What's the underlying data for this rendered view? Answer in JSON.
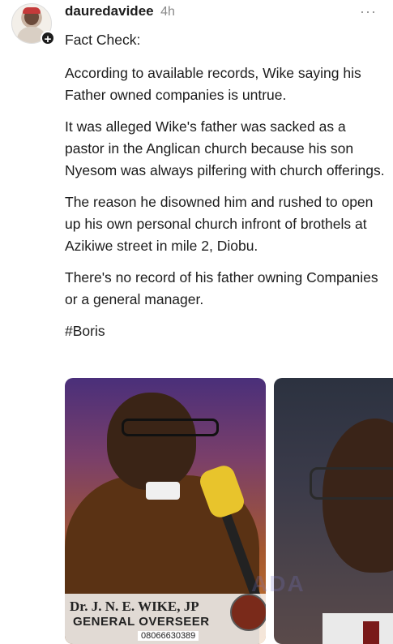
{
  "post": {
    "username": "dauredavidee",
    "time": "4h",
    "more_label": "···",
    "paragraphs": [
      "Fact Check:",
      "According to available records, Wike saying his Father owned companies is untrue.",
      "It was alleged Wike's father was sacked as a pastor in the Anglican church because his son Nyesom was always pilfering with church offerings.",
      "The reason he disowned him and rushed to open up his own personal church infront of brothels at Azikiwe street in mile 2, Diobu.",
      "There's no record of his father owning Companies or a general manager.",
      "#Boris"
    ]
  },
  "images": {
    "first": {
      "caption_name": "Dr. J. N. E. WIKE, JP",
      "caption_title": "GENERAL OVERSEER",
      "caption_phone": "08066630389"
    },
    "watermark": "ADA"
  },
  "icons": {
    "avatar": "avatar",
    "plus": "plus-icon",
    "more": "more-icon"
  }
}
